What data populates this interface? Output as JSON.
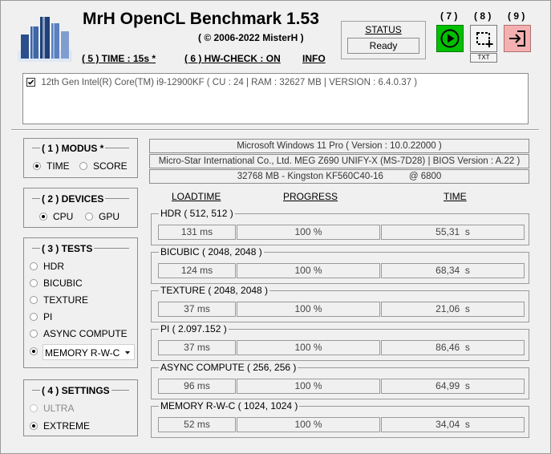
{
  "app": {
    "title": "MrH OpenCL Benchmark 1.53",
    "copyright": "( © 2006-2022 MisterH )"
  },
  "menu": {
    "time": "( 5 ) TIME : 15s *",
    "hwcheck": "( 6 ) HW-CHECK : ON",
    "info": "INFO"
  },
  "status": {
    "label": "STATUS",
    "value": "Ready"
  },
  "buttons": {
    "start": {
      "number": "( 7 )",
      "icon": "play-icon",
      "color": "#00c000"
    },
    "capture": {
      "number": "( 8 )",
      "icon": "screenshot-icon",
      "sublabel": "TXT"
    },
    "exit": {
      "number": "( 9 )",
      "icon": "exit-icon",
      "color": "#f4b0b0"
    }
  },
  "cpu": {
    "checked": true,
    "text": "12th Gen Intel(R) Core(TM) i9-12900KF ( CU : 24 | RAM : 32627 MB | VERSION : 6.4.0.37 )"
  },
  "modus": {
    "title": "( 1 ) MODUS *",
    "options": [
      {
        "label": "TIME",
        "selected": true
      },
      {
        "label": "SCORE",
        "selected": false
      }
    ]
  },
  "devices": {
    "title": "( 2 ) DEVICES",
    "options": [
      {
        "label": "CPU",
        "selected": true
      },
      {
        "label": "GPU",
        "selected": false
      }
    ]
  },
  "tests": {
    "title": "( 3 ) TESTS",
    "options": [
      {
        "label": "HDR",
        "selected": false
      },
      {
        "label": "BICUBIC",
        "selected": false
      },
      {
        "label": "TEXTURE",
        "selected": false
      },
      {
        "label": "PI",
        "selected": false
      },
      {
        "label": "ASYNC COMPUTE",
        "selected": false
      }
    ],
    "memory_option": {
      "value": "MEMORY R-W-C",
      "selected": true
    }
  },
  "settings": {
    "title": "( 4 ) SETTINGS",
    "options": [
      {
        "label": "ULTRA",
        "selected": false,
        "disabled": true
      },
      {
        "label": "EXTREME",
        "selected": true,
        "disabled": false
      }
    ]
  },
  "system": {
    "os": "Microsoft Windows 11 Pro ( Version : 10.0.22000 )",
    "board": "Micro-Star International Co., Ltd. MEG Z690 UNIFY-X (MS-7D28) | BIOS Version : A.22 )",
    "memory": "32768 MB - Kingston KF560C40-16          @ 6800"
  },
  "columns": {
    "loadtime": "LOADTIME",
    "progress": "PROGRESS",
    "time": "TIME"
  },
  "results": [
    {
      "name": "HDR ( 512, 512 )",
      "loadtime": "131 ms",
      "progress": "100 %",
      "time": "55,31  s"
    },
    {
      "name": "BICUBIC ( 2048, 2048 )",
      "loadtime": "124 ms",
      "progress": "100 %",
      "time": "68,34  s"
    },
    {
      "name": "TEXTURE ( 2048, 2048 )",
      "loadtime": "37 ms",
      "progress": "100 %",
      "time": "21,06  s"
    },
    {
      "name": "PI ( 2.097.152 )",
      "loadtime": "37 ms",
      "progress": "100 %",
      "time": "86,46  s"
    },
    {
      "name": "ASYNC COMPUTE ( 256, 256 )",
      "loadtime": "96 ms",
      "progress": "100 %",
      "time": "64,99  s"
    },
    {
      "name": "MEMORY R-W-C ( 1024, 1024 )",
      "loadtime": "52 ms",
      "progress": "100 %",
      "time": "34,04  s"
    }
  ]
}
